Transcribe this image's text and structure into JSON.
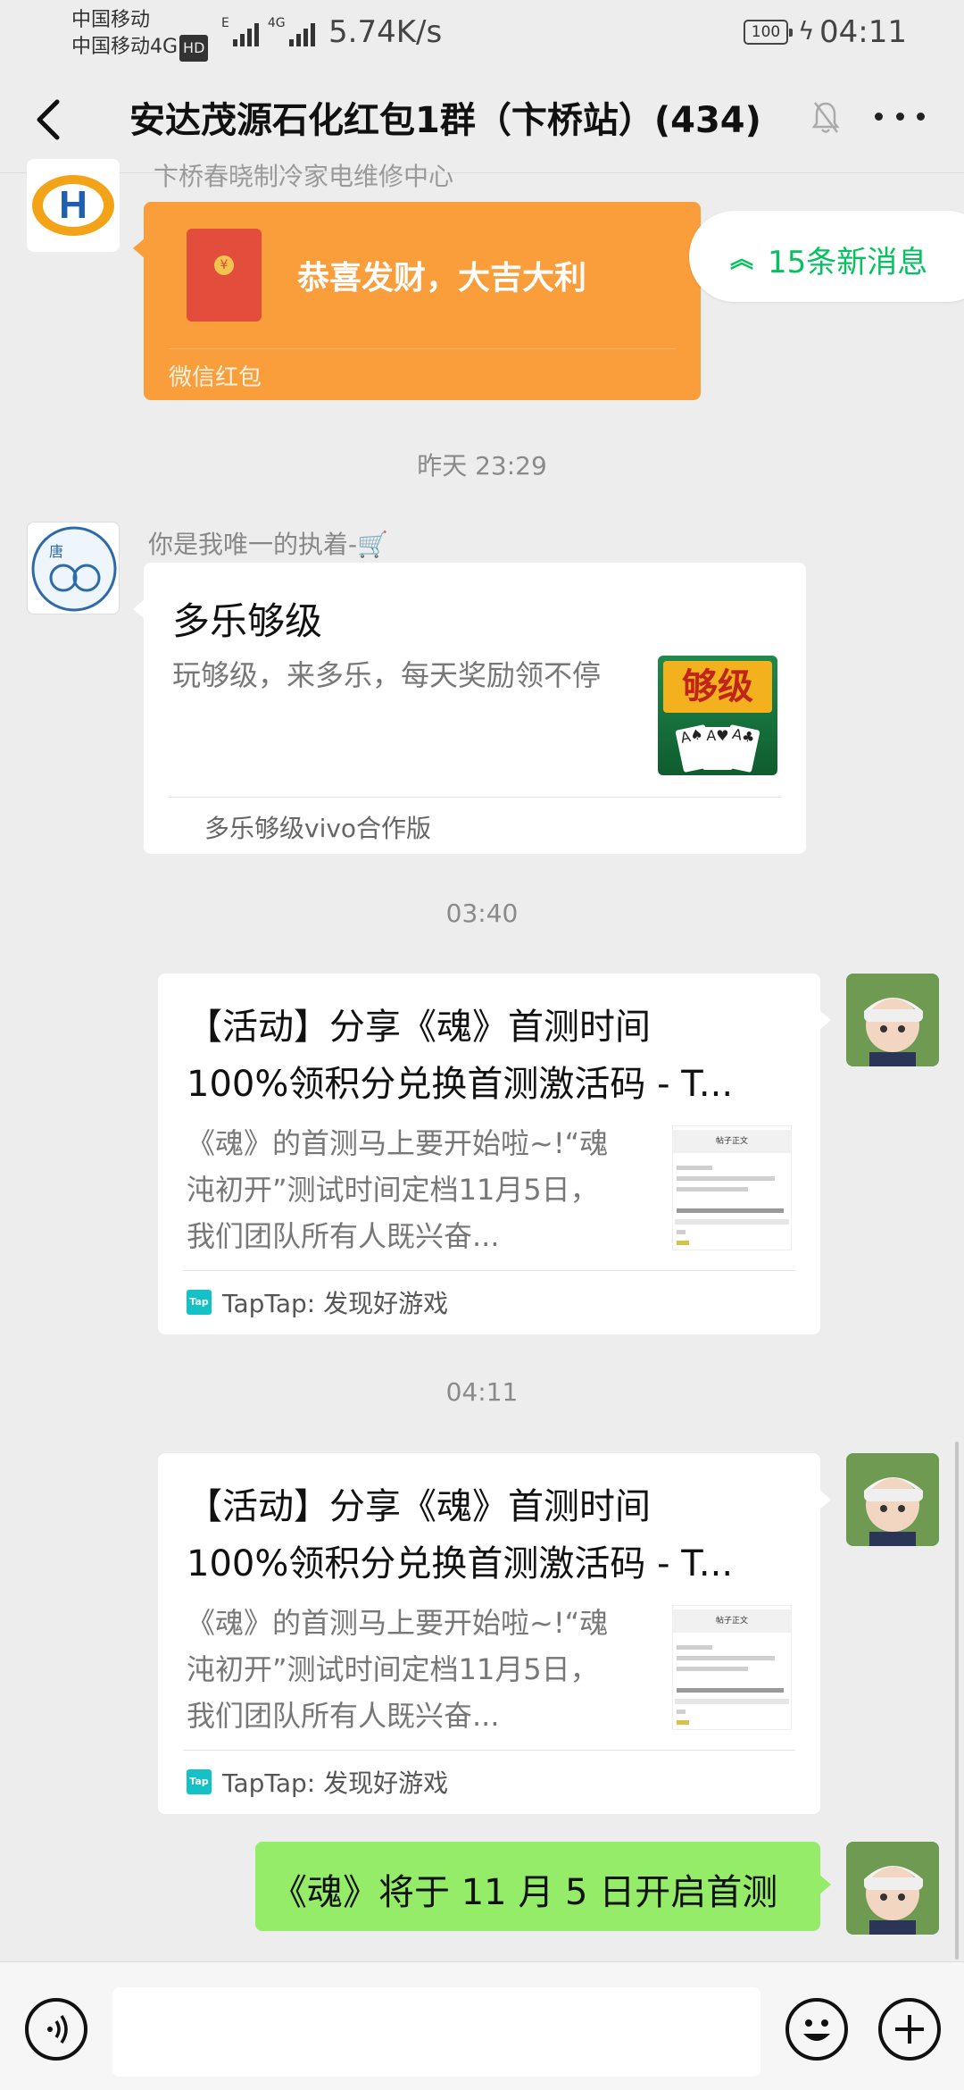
{
  "status_bar": {
    "carrier_1": "中国移动",
    "carrier_2": "中国移动4G",
    "hd_label": "HD",
    "network_label": "4G",
    "signal_label": "E",
    "net_speed": "5.74K/s",
    "battery": "100",
    "time": "04:11"
  },
  "header": {
    "title": "安达茂源石化红包1群（卞桥站）(434)",
    "back_icon": "chevron-left-icon",
    "mute_icon": "bell-off-icon",
    "more_icon": "more-dots-icon"
  },
  "messages": {
    "first_sender": "卞桥春晓制冷家电维修中心",
    "red_packet": {
      "wish": "恭喜发财，大吉大利",
      "footer": "微信红包",
      "icon": "red-envelope-icon"
    },
    "new_messages_pill": {
      "arrow": "»",
      "label": "15条新消息"
    },
    "timestamp_1": "昨天 23:29",
    "second_sender": "你是我唯一的执着-🛒",
    "mini_program": {
      "title": "多乐够级",
      "description": "玩够级，来多乐，每天奖励领不停",
      "thumbnail_text": "够级",
      "footer": "多乐够级vivo合作版"
    },
    "timestamp_2": "03:40",
    "link_card_1": {
      "title": "【活动】分享《魂》首测时间\n100%领积分兑换首测激活码 - T...",
      "description": "《魂》的首测马上要开始啦~!“魂沌初开”测试时间定档11月5日，我们团队所有人既兴奋...",
      "footer": "TapTap: 发现好游戏",
      "thumb_header": "帖子正文"
    },
    "timestamp_3": "04:11",
    "link_card_2": {
      "title": "【活动】分享《魂》首测时间\n100%领积分兑换首测激活码 - T...",
      "description": "《魂》的首测马上要开始啦~!“魂沌初开”测试时间定档11月5日，我们团队所有人既兴奋...",
      "footer": "TapTap: 发现好游戏",
      "thumb_header": "帖子正文"
    },
    "sent_text": "《魂》将于 11 月 5 日开启首测"
  },
  "input_bar": {
    "placeholder": "",
    "voice_icon": "voice-icon",
    "emoji_icon": "emoji-icon",
    "plus_icon": "plus-icon"
  },
  "colors": {
    "accent_green": "#07c160",
    "bubble_green": "#95ec69",
    "red_packet_orange": "#fa9d3b"
  }
}
